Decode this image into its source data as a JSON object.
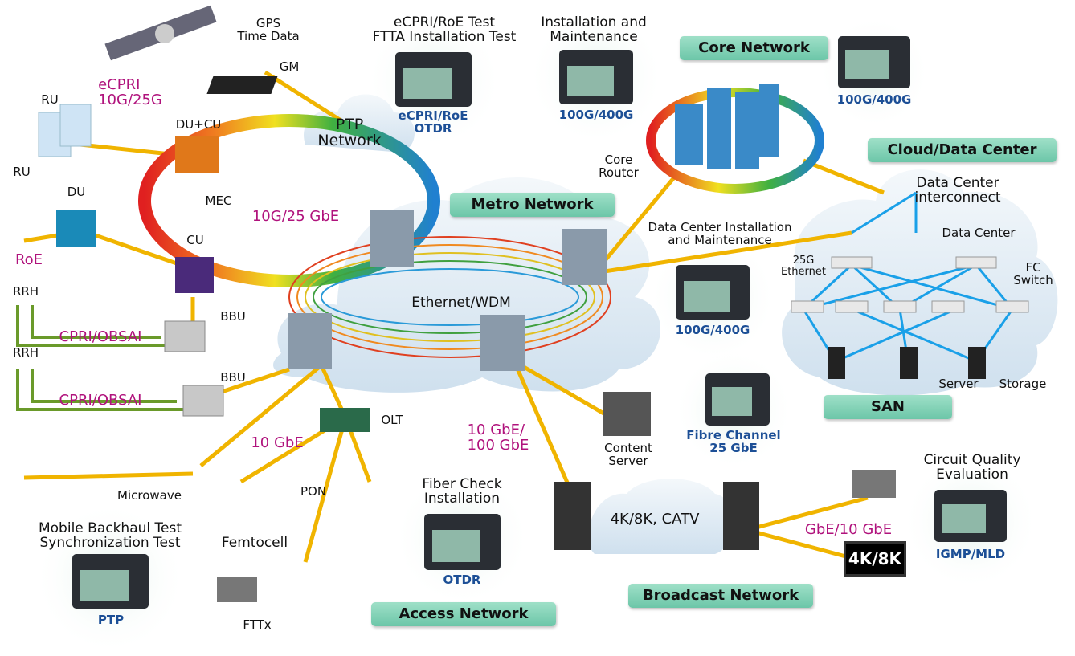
{
  "colors": {
    "link": "#f0b400",
    "copper": "#6a9a2a",
    "badge": "#7fd0b4",
    "magenta": "#b0127c",
    "tester_label": "#1c4f96",
    "wdm": "#2a9ad8",
    "fc_link": "#1aa0e8"
  },
  "sections": {
    "core": "Core Network",
    "cloud": "Cloud/Data Center",
    "metro": "Metro Network",
    "san": "SAN",
    "access": "Access Network",
    "broadcast": "Broadcast Network"
  },
  "testers": {
    "fronthaul": {
      "title": "eCPRI/RoE Test\nFTTA Installation Test",
      "label": "eCPRI/RoE\nOTDR"
    },
    "metro": {
      "title": "Installation and\nMaintenance",
      "label": "100G/400G"
    },
    "core": {
      "label": "100G/400G"
    },
    "datacenter": {
      "title": "Data Center Installation\nand Maintenance",
      "label": "100G/400G"
    },
    "san": {
      "label": "Fibre Channel\n25 GbE"
    },
    "access": {
      "title": "Fiber Check\nInstallation",
      "label": "OTDR"
    },
    "backhaul": {
      "title": "Mobile Backhaul Test\nSynchronization Test",
      "label": "PTP"
    },
    "broadcast": {
      "title": "Circuit Quality\nEvaluation",
      "label": "IGMP/MLD"
    }
  },
  "labels": {
    "gps": "GPS\nTime Data",
    "gm": "GM",
    "ptp_network": "PTP\nNetwork",
    "core_router": "Core\nRouter",
    "dci": "Data Center\ninterconnect",
    "data_center": "Data Center",
    "ethernet_25g": "25G\nEthernet",
    "fc_switch": "FC Switch",
    "server": "Server",
    "storage": "Storage",
    "ethernet_wdm": "Ethernet/WDM",
    "content_server": "Content\nServer",
    "catv": "4K/8K, CATV",
    "display_4k8k": "4K/8K",
    "olt": "OLT",
    "pon": "PON",
    "femtocell": "Femtocell",
    "fttx": "FTTx",
    "microwave": "Microwave",
    "bbu1": "BBU",
    "bbu2": "BBU",
    "rrh1": "RRH",
    "rrh2": "RRH",
    "cu": "CU",
    "du": "DU",
    "ru1": "RU",
    "ru2": "RU",
    "du_cu": "DU+CU",
    "mec": "MEC"
  },
  "rates": {
    "ecpri": "eCPRI\n10G/25G",
    "roe": "RoE",
    "ring": "10G/25 GbE",
    "cpri1": "CPRI/OBSAI",
    "cpri2": "CPRI/OBSAI",
    "access": "10 GbE",
    "broadcast_uplink": "10 GbE/\n100 GbE",
    "broadcast_out": "GbE/10 GbE"
  }
}
